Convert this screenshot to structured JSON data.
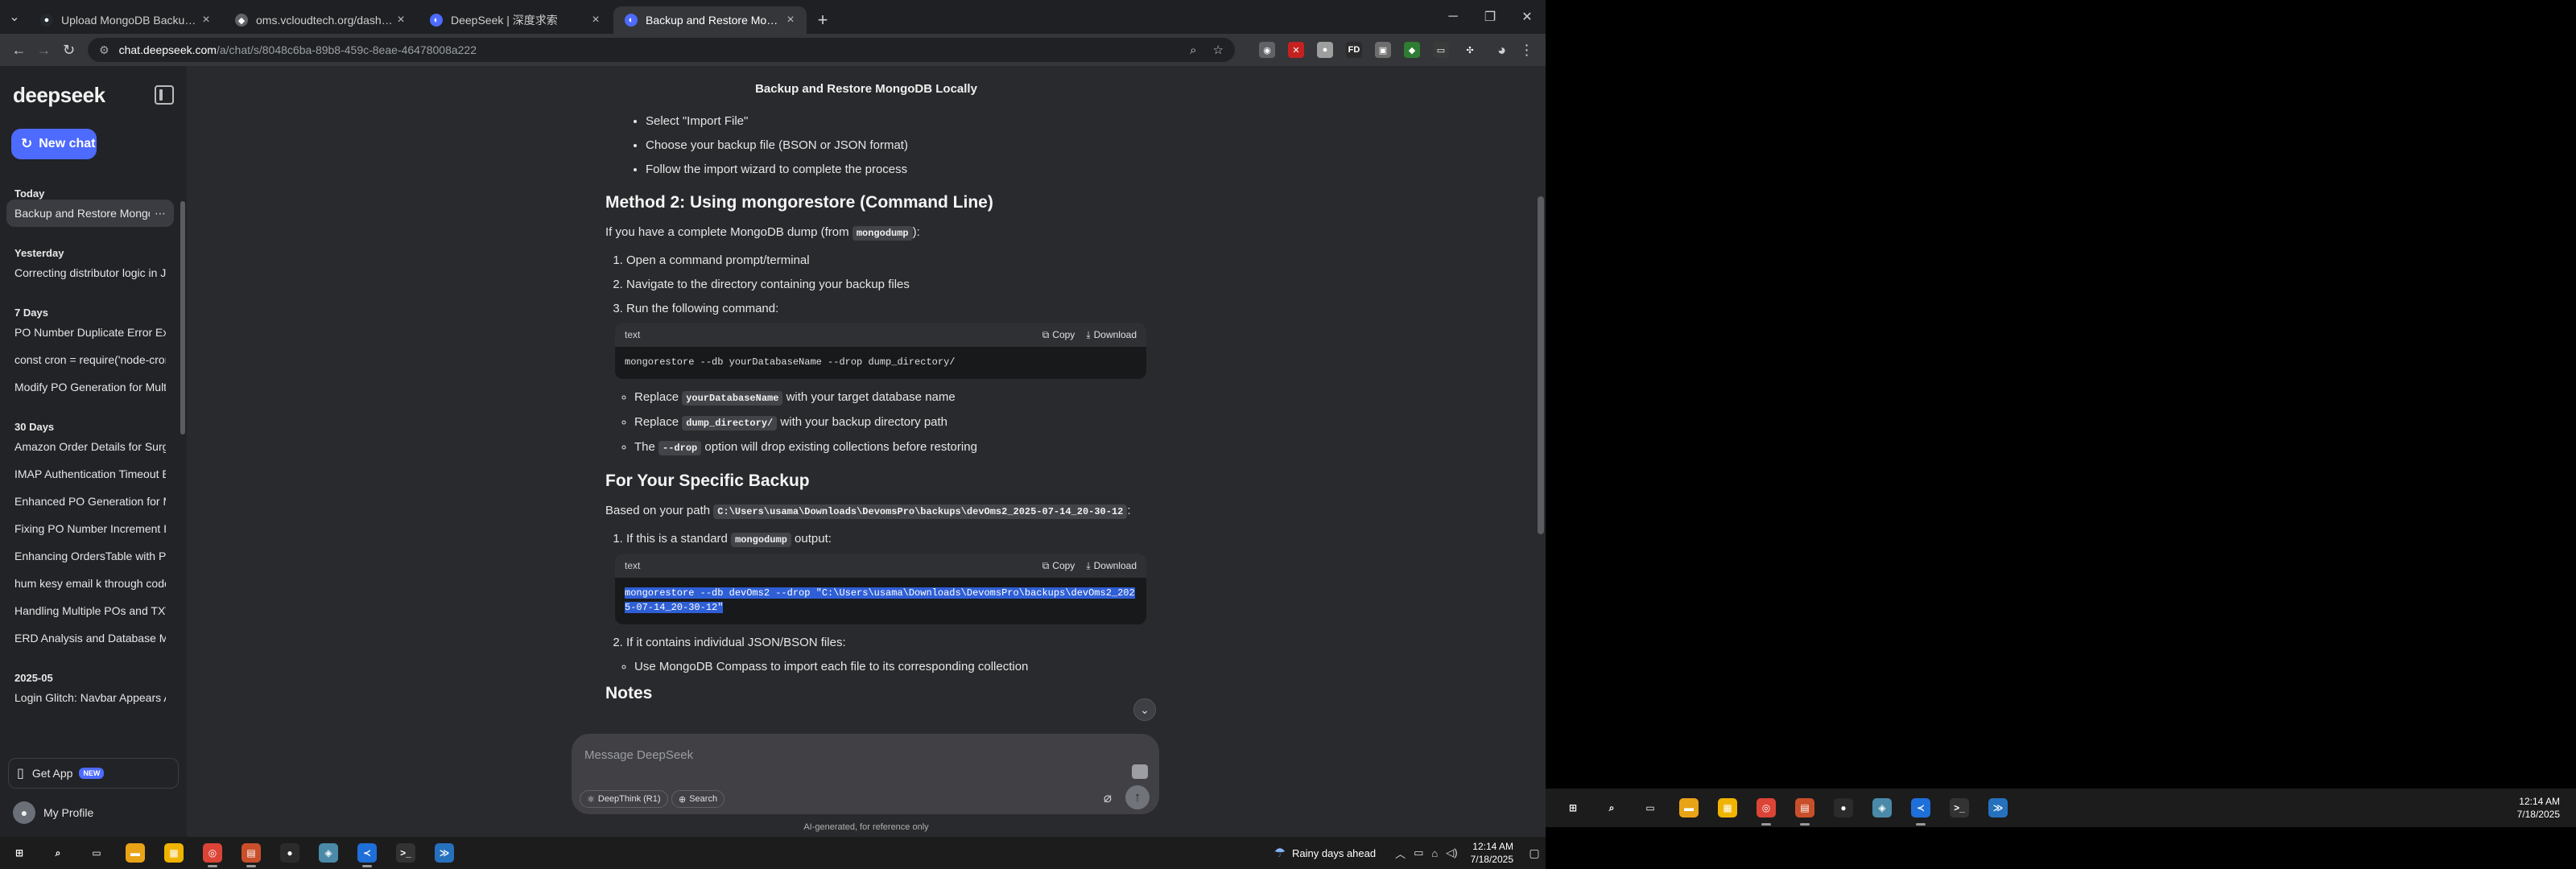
{
  "browser": {
    "tabs": [
      {
        "title": "Upload MongoDB Backup Local",
        "icon": "github-icon",
        "color": "#24292f",
        "glyph": "●",
        "active": false
      },
      {
        "title": "oms.vcloudtech.org/dashboard",
        "icon": "globe-icon",
        "color": "#5f6368",
        "glyph": "◆",
        "active": false
      },
      {
        "title": "DeepSeek | 深度求索",
        "icon": "deepseek-icon",
        "color": "#4d6bfe",
        "glyph": "◐",
        "active": false
      },
      {
        "title": "Backup and Restore MongoDB",
        "icon": "deepseek-icon",
        "color": "#4d6bfe",
        "glyph": "◐",
        "active": true
      }
    ],
    "new_tab": "+",
    "url_host": "chat.deepseek.com",
    "url_path": "/a/chat/s/8048c6ba-89b8-459c-8eae-46478008a222",
    "window_controls": {
      "minimize": "─",
      "restore": "❐",
      "close": "✕"
    }
  },
  "extensions": [
    {
      "name": "incognito-ext-icon",
      "color": "#5f6368",
      "glyph": "◉"
    },
    {
      "name": "red-x-ext-icon",
      "color": "#c5221f",
      "glyph": "✕"
    },
    {
      "name": "circle-ext-icon",
      "color": "#9e9e9e",
      "glyph": "●"
    },
    {
      "name": "fd-ext-icon",
      "color": "#2b2b2b",
      "glyph": "FD"
    },
    {
      "name": "image-ext-icon",
      "color": "#6d6d6d",
      "glyph": "▣"
    },
    {
      "name": "green-ext-icon",
      "color": "#2e7d32",
      "glyph": "◆"
    },
    {
      "name": "dark-ext-icon",
      "color": "#3a3a3a",
      "glyph": "▭"
    },
    {
      "name": "puzzle-ext-icon",
      "color": "#35363a",
      "glyph": "✣"
    }
  ],
  "sidebar": {
    "logo": "deepseek",
    "new_chat": "New chat",
    "groups": [
      {
        "label": "Today",
        "items": [
          {
            "label": "Backup and Restore MongoDB",
            "active": true
          }
        ]
      },
      {
        "label": "Yesterday",
        "items": [
          {
            "label": "Correcting distributor logic in JavaScript",
            "active": false
          }
        ]
      },
      {
        "label": "7 Days",
        "items": [
          {
            "label": "PO Number Duplicate Error Explained",
            "active": false
          },
          {
            "label": "const cron = require('node-cron');",
            "active": false
          },
          {
            "label": "Modify PO Generation for Multiple",
            "active": false
          }
        ]
      },
      {
        "label": "30 Days",
        "items": [
          {
            "label": "Amazon Order Details for Surgery",
            "active": false
          },
          {
            "label": "IMAP Authentication Timeout Error",
            "active": false
          },
          {
            "label": "Enhanced PO Generation for Multiple",
            "active": false
          },
          {
            "label": "Fixing PO Number Increment Issue",
            "active": false
          },
          {
            "label": "Enhancing OrdersTable with Product",
            "active": false
          },
          {
            "label": "hum kesy email k through code",
            "active": false
          },
          {
            "label": "Handling Multiple POs and TXWs",
            "active": false
          },
          {
            "label": "ERD Analysis and Database Model",
            "active": false
          }
        ]
      },
      {
        "label": "2025-05",
        "items": [
          {
            "label": "Login Glitch: Navbar Appears After",
            "active": false
          }
        ]
      }
    ],
    "get_app": "Get App",
    "new_badge": "NEW",
    "profile": "My Profile"
  },
  "chat": {
    "title": "Backup and Restore MongoDB Locally",
    "compass_steps": [
      "Select \"Import File\"",
      "Choose your backup file (BSON or JSON format)",
      "Follow the import wizard to complete the process"
    ],
    "method2_heading": "Method 2: Using mongorestore (Command Line)",
    "method2_intro_pre": "If you have a complete MongoDB dump (from ",
    "method2_intro_code": "mongodump",
    "method2_intro_post": "):",
    "method2_steps": [
      "Open a command prompt/terminal",
      "Navigate to the directory containing your backup files",
      "Run the following command:"
    ],
    "codeblock1": {
      "lang": "text",
      "copy": "Copy",
      "download": "Download",
      "code": "mongorestore --db yourDatabaseName --drop dump_directory/"
    },
    "replace_notes": [
      {
        "pre": "Replace ",
        "code": "yourDatabaseName",
        "post": " with your target database name"
      },
      {
        "pre": "Replace ",
        "code": "dump_directory/",
        "post": " with your backup directory path"
      },
      {
        "pre": "The ",
        "code": "--drop",
        "post": " option will drop existing collections before restoring"
      }
    ],
    "specific_heading": "For Your Specific Backup",
    "specific_intro_pre": "Based on your path ",
    "specific_intro_code": "C:\\Users\\usama\\Downloads\\DevomsPro\\backups\\devOms2_2025-07-14_20-30-12",
    "specific_intro_post": ":",
    "standard_pre": "If this is a standard ",
    "standard_code": "mongodump",
    "standard_post": " output:",
    "codeblock2": {
      "lang": "text",
      "copy": "Copy",
      "download": "Download",
      "code": "mongorestore --db devOms2 --drop \"C:\\Users\\usama\\Downloads\\DevomsPro\\backups\\devOms2_2025-07-14_20-30-12\""
    },
    "json_item": "If it contains individual JSON/BSON files:",
    "json_sub": "Use MongoDB Compass to import each file to its corresponding collection",
    "notes_heading": "Notes"
  },
  "composer": {
    "placeholder": "Message DeepSeek",
    "deepthink": "DeepThink (R1)",
    "search": "Search"
  },
  "disclaimer": "AI-generated, for reference only",
  "taskbar": {
    "weather": "Rainy days ahead",
    "time": "12:14 AM",
    "date": "7/18/2025"
  },
  "taskbar_apps": [
    {
      "name": "start-icon",
      "color": "#1c1c1c",
      "glyph": "⊞",
      "running": false
    },
    {
      "name": "search-icon",
      "color": "#1c1c1c",
      "glyph": "⌕",
      "running": false
    },
    {
      "name": "task-view-icon",
      "color": "#1c1c1c",
      "glyph": "▭",
      "running": false
    },
    {
      "name": "file-explorer-icon",
      "color": "#e8a317",
      "glyph": "▬",
      "running": false
    },
    {
      "name": "store-icon",
      "color": "#f0b400",
      "glyph": "▦",
      "running": false
    },
    {
      "name": "chrome-icon",
      "color": "#db4437",
      "glyph": "◎",
      "running": true
    },
    {
      "name": "app-red-icon",
      "color": "#c94f2b",
      "glyph": "▤",
      "running": true
    },
    {
      "name": "app-dark-icon",
      "color": "#2b2b2b",
      "glyph": "●",
      "running": false
    },
    {
      "name": "app-teal-icon",
      "color": "#4a8aa8",
      "glyph": "◈",
      "running": false
    },
    {
      "name": "vscode-icon",
      "color": "#1e6fd9",
      "glyph": "≺",
      "running": true
    },
    {
      "name": "terminal-icon",
      "color": "#333",
      "glyph": ">_",
      "running": false
    },
    {
      "name": "powershell-icon",
      "color": "#2671be",
      "glyph": "≫",
      "running": false
    }
  ]
}
